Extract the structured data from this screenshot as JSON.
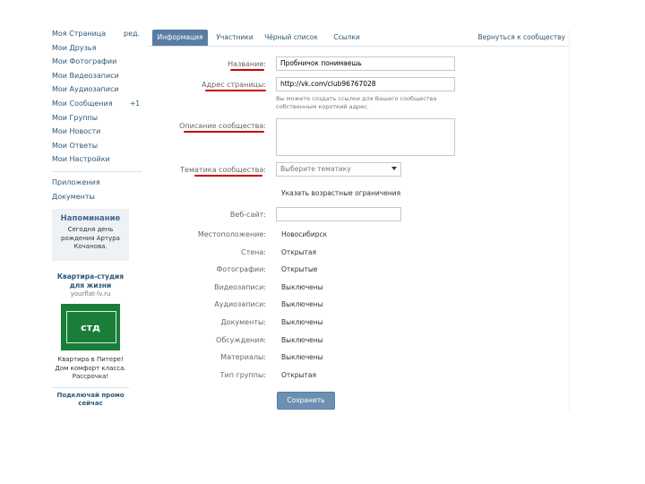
{
  "left_nav": {
    "items": [
      {
        "label": "Моя Страница",
        "extra": "ред."
      },
      {
        "label": "Мои Друзья"
      },
      {
        "label": "Мои Фотографии"
      },
      {
        "label": "Мои Видеозаписи"
      },
      {
        "label": "Мои Аудиозаписи"
      },
      {
        "label": "Мои Сообщения",
        "badge": "+1"
      },
      {
        "label": "Мои Группы"
      },
      {
        "label": "Мои Новости"
      },
      {
        "label": "Мои Ответы"
      },
      {
        "label": "Мои Настройки"
      }
    ],
    "secondary": [
      {
        "label": "Приложения"
      },
      {
        "label": "Документы"
      }
    ]
  },
  "reminder": {
    "title": "Напоминание",
    "text": "Сегодня день рождения Артура Кочанова."
  },
  "ad": {
    "title": "Квартира-студия для жизни",
    "domain": "yourflat-lv.ru",
    "image_label": "стд",
    "text": "Квартира в Питере! Дом комфорт класса. Рассрочка!",
    "more": "Подключай промо сейчас"
  },
  "tabs": {
    "items": [
      "Информация",
      "Участники",
      "Чёрный список",
      "Ссылки"
    ],
    "active_index": 0,
    "back_label": "Вернуться к сообществу"
  },
  "form": {
    "name": {
      "label": "Название:",
      "value": "Пробничок понимаешь"
    },
    "address": {
      "label": "Адрес страницы:",
      "value": "http://vk.com/club96767028",
      "hint": "Вы можете создать ссылки для Вашего сообщества собственным короткий адрес."
    },
    "description": {
      "label": "Описание сообщества:",
      "value": ""
    },
    "topic": {
      "label": "Тематика сообщества:",
      "placeholder": "Выберите тематику"
    },
    "age_limit": {
      "label": "Указать возрастные ограничения"
    },
    "website": {
      "label": "Веб-сайт:",
      "value": ""
    },
    "location": {
      "label": "Местоположение:",
      "value": "Новосибирск"
    },
    "wall": {
      "label": "Стена:",
      "value": "Открытая"
    },
    "photos": {
      "label": "Фотографии:",
      "value": "Открытые"
    },
    "videos": {
      "label": "Видеозаписи:",
      "value": "Выключены"
    },
    "audios": {
      "label": "Аудиозаписи:",
      "value": "Выключены"
    },
    "documents": {
      "label": "Документы:",
      "value": "Выключены"
    },
    "discussions": {
      "label": "Обсуждения:",
      "value": "Выключены"
    },
    "materials": {
      "label": "Материалы:",
      "value": "Выключены"
    },
    "group_type": {
      "label": "Тип группы:",
      "value": "Открытая"
    },
    "save_label": "Сохранить"
  },
  "colors": {
    "accent": "#597da3",
    "link": "#2b587a",
    "annotation": "#cc0000"
  }
}
